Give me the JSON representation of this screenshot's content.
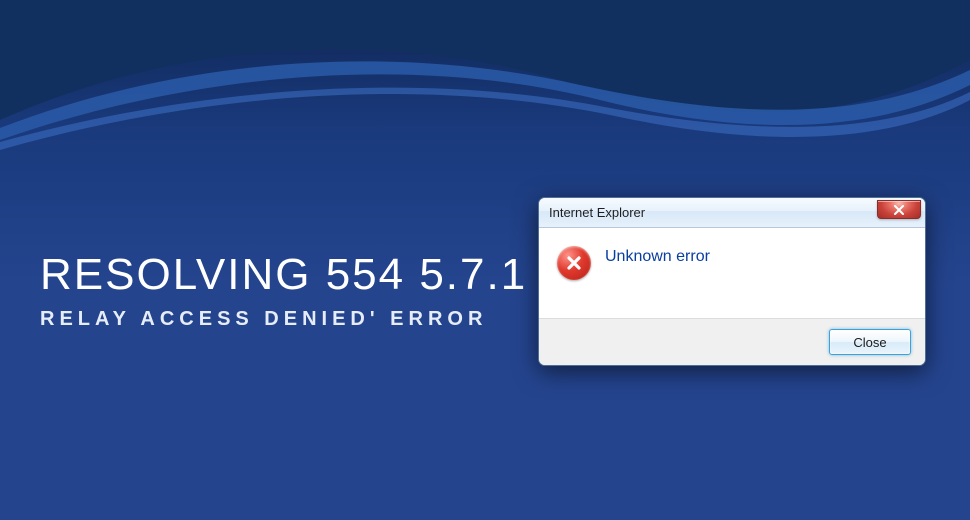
{
  "hero": {
    "title": "RESOLVING 554 5.7.1",
    "subtitle": "RELAY ACCESS DENIED' ERROR"
  },
  "dialog": {
    "title": "Internet Explorer",
    "message": "Unknown error",
    "close_button_label": "Close",
    "icons": {
      "error": "error-circle-x",
      "close_window": "close-x"
    }
  },
  "colors": {
    "background_primary": "#24448e",
    "background_dark": "#0f2654",
    "text_light": "#ffffff",
    "dialog_message": "#0a3ea0",
    "close_red": "#c9423a",
    "button_border": "#3ca3d9"
  }
}
